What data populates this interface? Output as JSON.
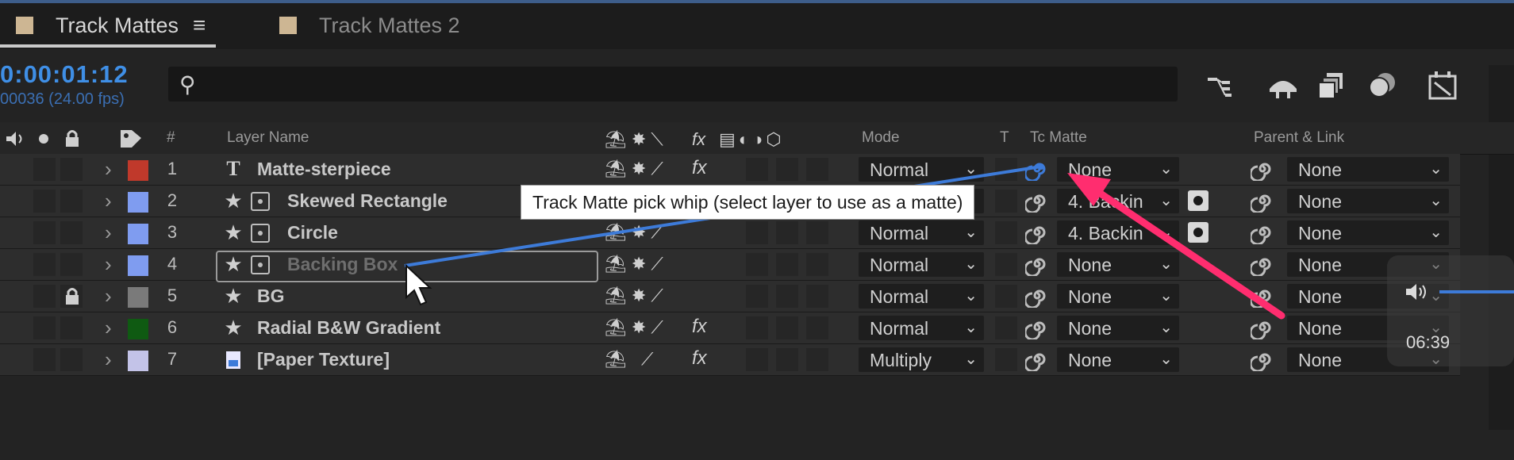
{
  "tabs": [
    {
      "label": "Track Mattes",
      "menu": "≡",
      "active": true
    },
    {
      "label": "Track Mattes 2",
      "active": false
    }
  ],
  "timecode": "0:00:01:12",
  "frames": "00036 (24.00 fps)",
  "search": {
    "placeholder": "",
    "icon": "search-icon"
  },
  "columns": {
    "number": "#",
    "layer_name": "Layer Name",
    "mode": "Mode",
    "t": "T",
    "track_matte": "Tc Matte",
    "parent": "Parent & Link",
    "switches_label": "fx"
  },
  "layers": [
    {
      "num": "1",
      "type": "T",
      "name": "Matte-sterpiece",
      "mode": "Normal",
      "matte": "None",
      "parent": "None",
      "label_color": "#c0392b",
      "fx": "fx"
    },
    {
      "num": "2",
      "type": "★",
      "name": "Skewed Rectangle",
      "mode": "Normal",
      "matte": "4. Backin",
      "parent": "None",
      "label_color": "#7f9cf0",
      "fx": ""
    },
    {
      "num": "3",
      "type": "★",
      "name": "Circle",
      "mode": "Normal",
      "matte": "4. Backin",
      "parent": "None",
      "label_color": "#7f9cf0",
      "fx": ""
    },
    {
      "num": "4",
      "type": "★",
      "name": "Backing Box",
      "mode": "Normal",
      "matte": "None",
      "parent": "None",
      "label_color": "#7f9cf0",
      "fx": ""
    },
    {
      "num": "5",
      "type": "★",
      "name": "BG",
      "mode": "Normal",
      "matte": "None",
      "parent": "None",
      "label_color": "#7a7a7a",
      "fx": ""
    },
    {
      "num": "6",
      "type": "★",
      "name": "Radial B&W Gradient",
      "mode": "Normal",
      "matte": "None",
      "parent": "None",
      "label_color": "#0f5a12",
      "fx": "fx"
    },
    {
      "num": "7",
      "type": "▤",
      "name": "[Paper Texture]",
      "mode": "Multiply",
      "matte": "None",
      "parent": "None",
      "label_color": "#c3c3e8",
      "fx": "fx"
    }
  ],
  "tooltip": "Track Matte pick whip (select layer to use as a matte)",
  "player": {
    "time": "06:39",
    "volume_icon": "speaker-icon"
  },
  "colors": {
    "accent": "#3f8fe6",
    "arrow": "#ff2d6f",
    "whip": "#3d7bd9"
  }
}
